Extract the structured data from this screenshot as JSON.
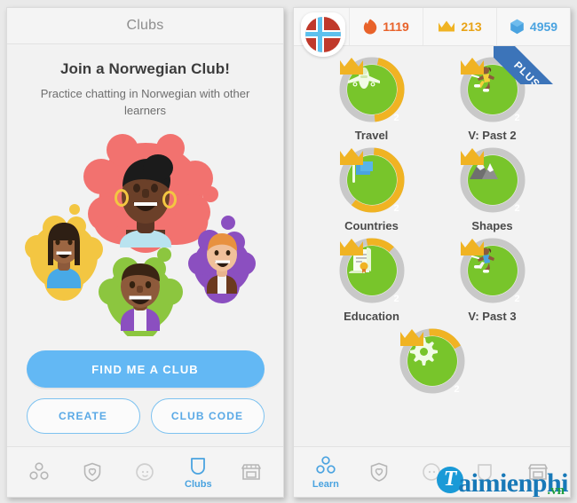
{
  "left_phone": {
    "title": "Clubs",
    "headline": "Join a Norwegian Club!",
    "subheadline": "Practice chatting in Norwegian with other learners",
    "illustration_name": "club-members-illustration",
    "buttons": {
      "primary": "FIND ME A CLUB",
      "create": "CREATE",
      "club_code": "CLUB CODE"
    },
    "tabs": [
      {
        "icon": "learn-circles-icon",
        "label": "",
        "active": false
      },
      {
        "icon": "shield-heart-icon",
        "label": "",
        "active": false
      },
      {
        "icon": "profile-face-icon",
        "label": "",
        "active": false
      },
      {
        "icon": "clubs-shield-icon",
        "label": "Clubs",
        "active": true
      },
      {
        "icon": "shop-store-icon",
        "label": "",
        "active": false
      }
    ]
  },
  "right_phone": {
    "flag": {
      "icon": "norway-flag-icon",
      "country": "Norway"
    },
    "stats": [
      {
        "icon": "streak-flame-icon",
        "value": "1119",
        "color": "#e8622a"
      },
      {
        "icon": "crown-icon",
        "value": "213",
        "color": "#e8a317"
      },
      {
        "icon": "gem-icon",
        "value": "4959",
        "color": "#4aa3e0"
      }
    ],
    "ribbon": "PLUS",
    "skills": [
      {
        "label": "Travel",
        "icon": "airplane-icon",
        "crown": "2",
        "progress": 45
      },
      {
        "label": "V: Past 2",
        "icon": "runner-icon",
        "crown": "2",
        "progress": 0
      },
      {
        "label": "Countries",
        "icon": "flag-blue-icon",
        "crown": "2",
        "progress": 60
      },
      {
        "label": "Shapes",
        "icon": "mountain-icon",
        "crown": "2",
        "progress": 0
      },
      {
        "label": "Education",
        "icon": "diploma-icon",
        "crown": "2",
        "progress": 14
      },
      {
        "label": "V: Past 3",
        "icon": "runner-icon",
        "crown": "2",
        "progress": 0
      },
      {
        "label": "",
        "icon": "gear-icon",
        "crown": "2",
        "progress": 18
      }
    ],
    "tabs": [
      {
        "icon": "learn-circles-icon",
        "label": "Learn",
        "active": true
      },
      {
        "icon": "shield-heart-icon",
        "label": "",
        "active": false
      },
      {
        "icon": "profile-face-icon",
        "label": "",
        "active": false
      },
      {
        "icon": "clubs-shield-icon",
        "label": "",
        "active": false
      },
      {
        "icon": "shop-store-icon",
        "label": "",
        "active": false
      }
    ]
  },
  "watermark": {
    "mark": "T",
    "name": "aimienphi",
    "tld": ".vn"
  }
}
